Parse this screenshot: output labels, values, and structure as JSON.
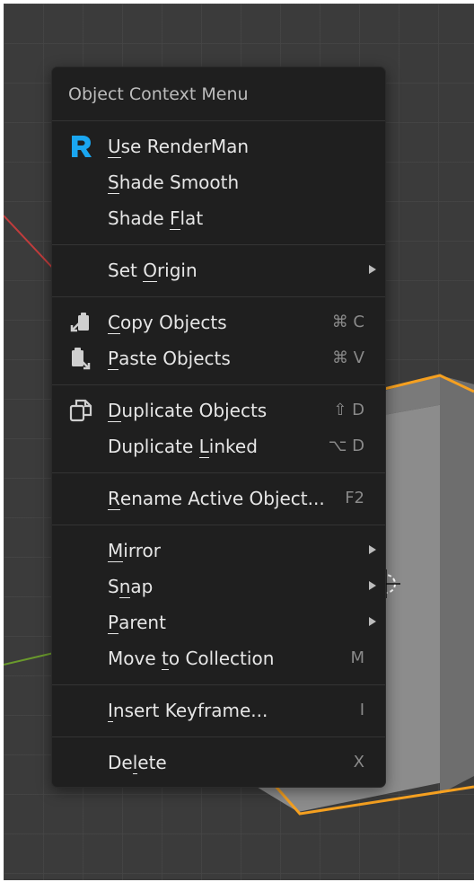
{
  "colors": {
    "viewport_bg": "#3b3b3b",
    "menu_bg": "#1f1f1f",
    "text": "#e6e6e6",
    "shortcut_text": "#8a8a8a",
    "selection_outline": "#f5a020",
    "renderman_blue": "#1aa6f0",
    "x_axis": "#c23c3c",
    "y_axis": "#6a9a2c"
  },
  "menu": {
    "title": "Object Context Menu",
    "items": [
      {
        "label": "Use RenderMan",
        "underline": "U",
        "icon": "renderman-icon",
        "shortcut": "",
        "submenu": false
      },
      {
        "label": "Shade Smooth",
        "underline": "S",
        "icon": "",
        "shortcut": "",
        "submenu": false
      },
      {
        "label": "Shade Flat",
        "underline": "F",
        "icon": "",
        "shortcut": "",
        "submenu": false
      },
      {
        "label": "Set Origin",
        "underline": "O",
        "icon": "",
        "shortcut": "",
        "submenu": true
      },
      {
        "label": "Copy Objects",
        "underline": "C",
        "icon": "copy-icon",
        "shortcut": "⌘ C",
        "submenu": false
      },
      {
        "label": "Paste Objects",
        "underline": "P",
        "icon": "paste-icon",
        "shortcut": "⌘ V",
        "submenu": false
      },
      {
        "label": "Duplicate Objects",
        "underline": "D",
        "icon": "duplicate-icon",
        "shortcut": "⇧ D",
        "submenu": false
      },
      {
        "label": "Duplicate Linked",
        "underline": "L",
        "icon": "",
        "shortcut": "⌥ D",
        "submenu": false
      },
      {
        "label": "Rename Active Object...",
        "underline": "R",
        "icon": "",
        "shortcut": "F2",
        "submenu": false
      },
      {
        "label": "Mirror",
        "underline": "M",
        "icon": "",
        "shortcut": "",
        "submenu": true
      },
      {
        "label": "Snap",
        "underline": "n",
        "icon": "",
        "shortcut": "",
        "submenu": true
      },
      {
        "label": "Parent",
        "underline": "P",
        "icon": "",
        "shortcut": "",
        "submenu": true
      },
      {
        "label": "Move to Collection",
        "underline": "t",
        "icon": "",
        "shortcut": "M",
        "submenu": false
      },
      {
        "label": "Insert Keyframe...",
        "underline": "I",
        "icon": "",
        "shortcut": "I",
        "submenu": false
      },
      {
        "label": "Delete",
        "underline": "l",
        "icon": "",
        "shortcut": "X",
        "submenu": false
      }
    ]
  }
}
